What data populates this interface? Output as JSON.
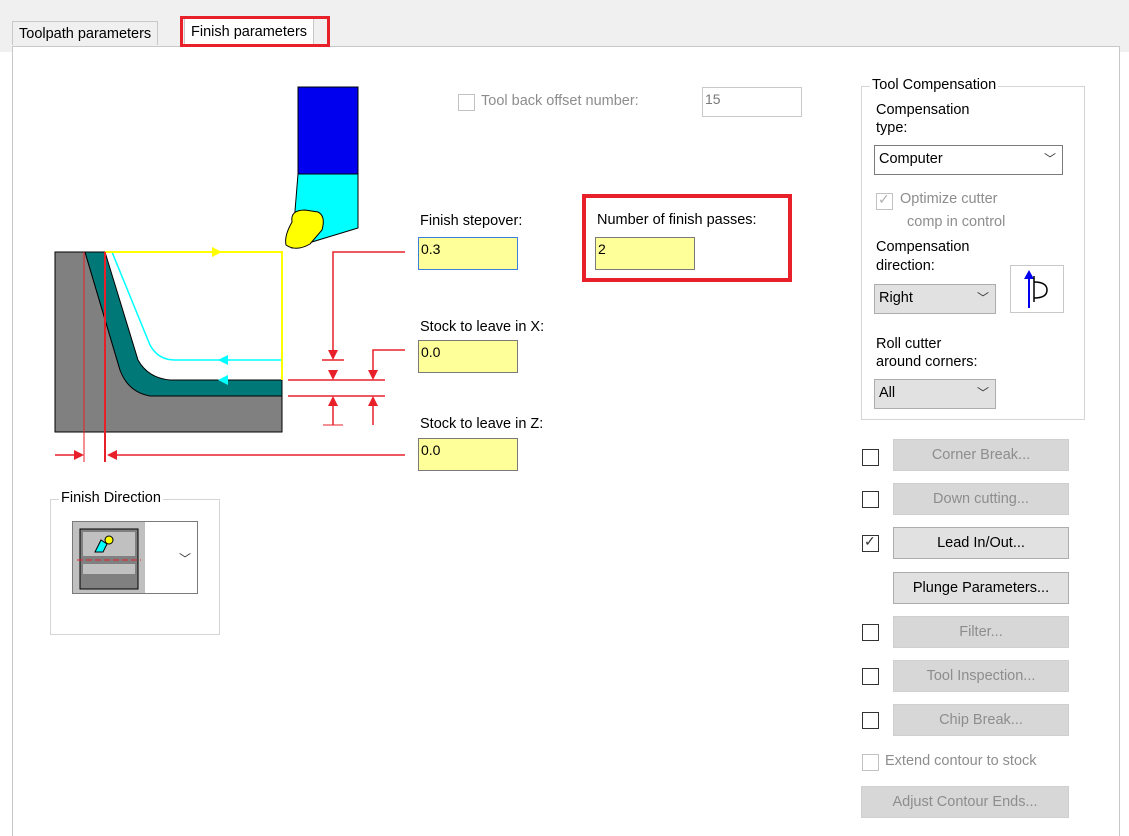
{
  "tabs": [
    {
      "label": "Toolpath parameters"
    },
    {
      "label": "Finish parameters"
    }
  ],
  "tool_back_offset": {
    "label": "Tool back offset number:",
    "value": "15"
  },
  "finish_stepover": {
    "label": "Finish stepover:",
    "value": "0.3"
  },
  "finish_passes": {
    "label": "Number of finish passes:",
    "value": "2"
  },
  "stock_x": {
    "label": "Stock to leave in X:",
    "value": "0.0"
  },
  "stock_z": {
    "label": "Stock to leave in Z:",
    "value": "0.0"
  },
  "finish_direction": {
    "title": "Finish Direction"
  },
  "tool_comp": {
    "title": "Tool Compensation",
    "type_label_1": "Compensation",
    "type_label_2": "type:",
    "type_value": "Computer",
    "optimize_1": "Optimize cutter",
    "optimize_2": "comp in control",
    "direction_label_1": "Compensation",
    "direction_label_2": "direction:",
    "direction_value": "Right",
    "roll_label_1": "Roll cutter",
    "roll_label_2": "around corners:",
    "roll_value": "All"
  },
  "buttons": {
    "corner_break": "Corner Break...",
    "down_cutting": "Down cutting...",
    "lead_inout": "Lead In/Out...",
    "plunge": "Plunge Parameters...",
    "filter": "Filter...",
    "tool_inspection": "Tool Inspection...",
    "chip_break": "Chip Break...",
    "adjust_contour": "Adjust Contour Ends..."
  },
  "extend_contour": "Extend contour to stock",
  "colors": {
    "highlight": "#e8202a",
    "input_bg": "#ffff99"
  }
}
